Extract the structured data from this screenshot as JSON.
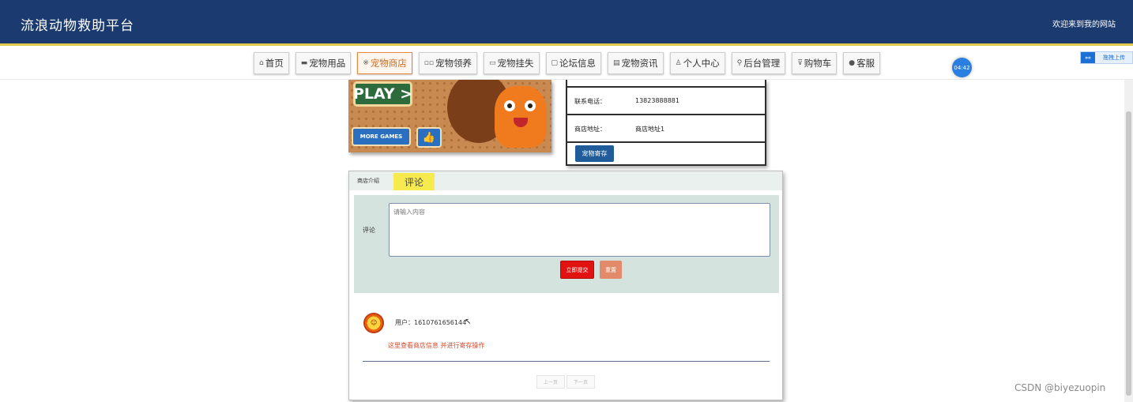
{
  "header": {
    "title": "流浪动物救助平台",
    "welcome": "欢迎来到我的网站"
  },
  "nav": {
    "items": [
      {
        "label": "首页",
        "icon": "home-icon"
      },
      {
        "label": "宠物用品",
        "icon": "box-icon"
      },
      {
        "label": "宠物商店",
        "icon": "store-icon",
        "active": true
      },
      {
        "label": "宠物领养",
        "icon": "adopt-icon"
      },
      {
        "label": "宠物挂失",
        "icon": "lost-icon"
      },
      {
        "label": "论坛信息",
        "icon": "forum-icon"
      },
      {
        "label": "宠物资讯",
        "icon": "news-icon"
      },
      {
        "label": "个人中心",
        "icon": "user-icon"
      },
      {
        "label": "后台管理",
        "icon": "link-icon"
      },
      {
        "label": "购物车",
        "icon": "cart-icon"
      },
      {
        "label": "客服",
        "icon": "service-icon"
      }
    ],
    "active_color": "#d26a1b"
  },
  "timer": "04:42",
  "upload": {
    "label": "拖拽上传"
  },
  "game_image": {
    "play_label": "PLAY",
    "more_games_label": "MORE GAMES"
  },
  "shop_info": {
    "phone_label": "联系电话：",
    "phone_value": "13823888881",
    "address_label": "商店地址：",
    "address_value": "商店地址1",
    "store_button": "宠物寄存"
  },
  "comment_panel": {
    "tab_intro": "商店介绍",
    "tab_comment": "评论",
    "form_label": "评论",
    "textarea_placeholder": "请输入内容",
    "submit_label": "立即提交",
    "reset_label": "重置",
    "comments": [
      {
        "user": "用户：1610761656144",
        "text": "这里查看商店信息 并进行寄存操作"
      }
    ],
    "pager_prev": "上一页",
    "pager_next": "下一页"
  },
  "watermark": "CSDN @biyezuopin",
  "colors": {
    "header_bg": "#1b3a6f",
    "accent_yellow": "#e2c94a",
    "submit_red": "#e11212",
    "reset_orange": "#e38a6a",
    "comment_red": "#d34b2b",
    "form_bg": "#d5e3df"
  }
}
